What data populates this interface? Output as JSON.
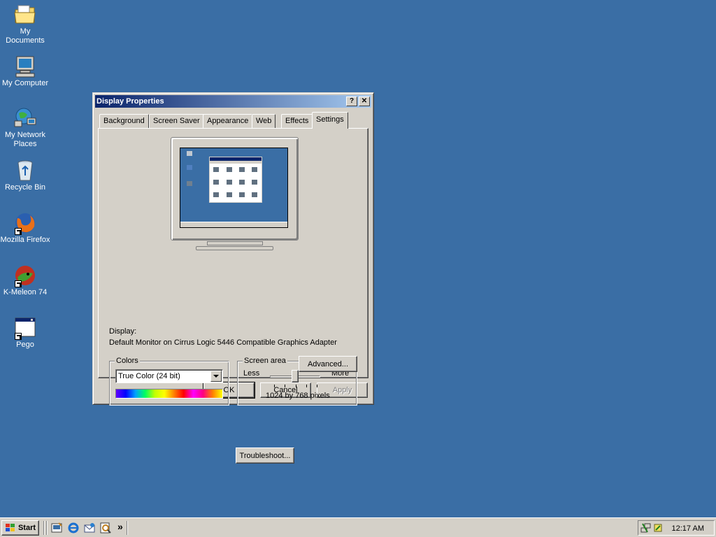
{
  "desktop": {
    "icons": [
      {
        "label": "My Documents",
        "icon": "folder-documents-icon"
      },
      {
        "label": "My Computer",
        "icon": "computer-icon"
      },
      {
        "label": "My Network Places",
        "icon": "network-places-icon"
      },
      {
        "label": "Recycle Bin",
        "icon": "recycle-bin-icon"
      },
      {
        "label": "Mozilla Firefox",
        "icon": "firefox-icon"
      },
      {
        "label": "K-Meleon 74",
        "icon": "kmeleon-icon"
      },
      {
        "label": "Pego",
        "icon": "application-window-icon"
      }
    ],
    "background_color": "#3a6ea5"
  },
  "dialog": {
    "title": "Display Properties",
    "help_button": "?",
    "close_button": "✕",
    "tabs": [
      {
        "label": "Background",
        "active": false
      },
      {
        "label": "Screen Saver",
        "active": false
      },
      {
        "label": "Appearance",
        "active": false
      },
      {
        "label": "Web",
        "active": false
      },
      {
        "label": "Effects",
        "active": false
      },
      {
        "label": "Settings",
        "active": true
      }
    ],
    "settings": {
      "display_label": "Display:",
      "display_value": "Default Monitor on Cirrus Logic 5446 Compatible Graphics Adapter",
      "colors": {
        "group_title": "Colors",
        "selected": "True Color (24 bit)"
      },
      "screen_area": {
        "group_title": "Screen area",
        "less_label": "Less",
        "more_label": "More",
        "resolution_text": "1024 by 768 pixels",
        "slider_position": 0.5
      },
      "troubleshoot_button": "Troubleshoot...",
      "advanced_button": "Advanced..."
    },
    "ok_button": "OK",
    "cancel_button": "Cancel",
    "apply_button": "Apply"
  },
  "taskbar": {
    "start_label": "Start",
    "quick_launch": [
      "show-desktop-icon",
      "internet-explorer-icon",
      "outlook-express-icon",
      "search-icon"
    ],
    "overflow_label": "»",
    "clock": "12:17 AM"
  }
}
